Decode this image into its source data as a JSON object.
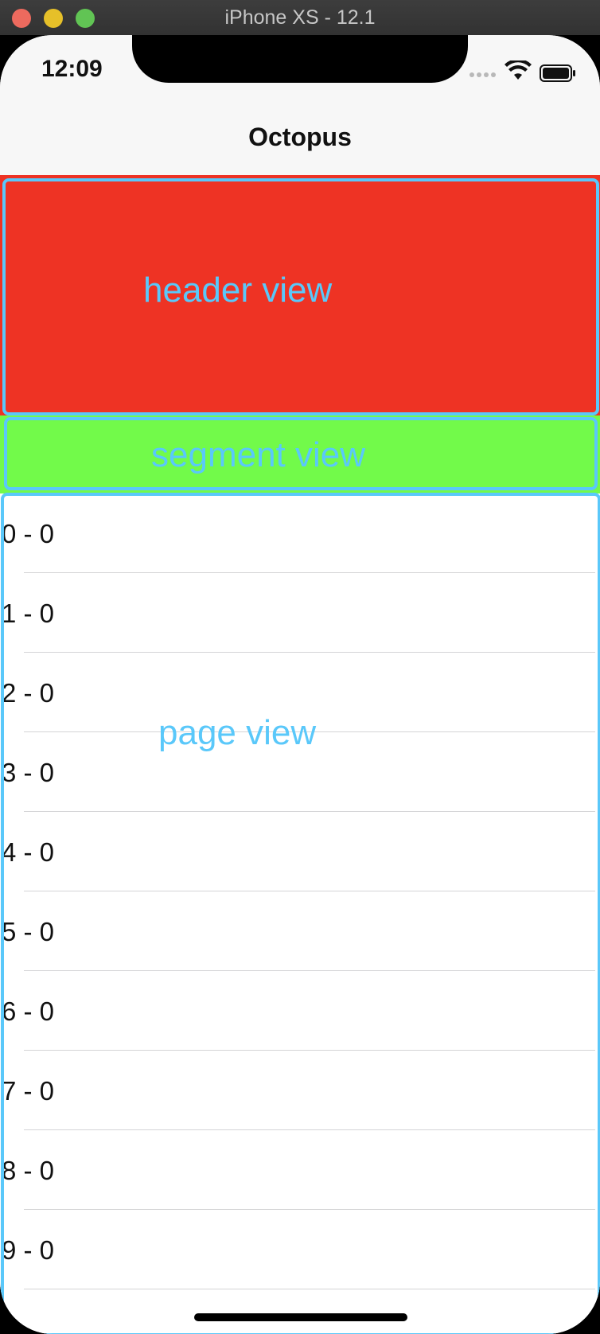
{
  "window": {
    "title": "iPhone XS - 12.1"
  },
  "status_bar": {
    "time": "12:09"
  },
  "nav_bar": {
    "title": "Octopus"
  },
  "debug_labels": {
    "header": "header view",
    "segment": "segment view",
    "page": "page view"
  },
  "colors": {
    "header_background": "#ee3324",
    "segment_background": "#72fa4a",
    "debug_border": "#5ac8fa"
  },
  "table": {
    "rows": [
      {
        "label": "0 - 0"
      },
      {
        "label": "1 - 0"
      },
      {
        "label": "2 - 0"
      },
      {
        "label": "3 - 0"
      },
      {
        "label": "4 - 0"
      },
      {
        "label": "5 - 0"
      },
      {
        "label": "6 - 0"
      },
      {
        "label": "7 - 0"
      },
      {
        "label": "8 - 0"
      },
      {
        "label": "9 - 0"
      }
    ]
  }
}
